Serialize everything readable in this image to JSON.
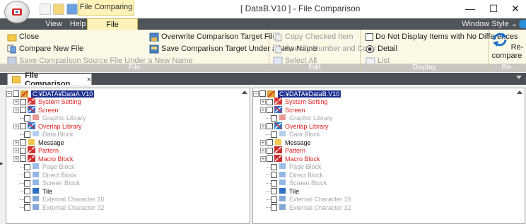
{
  "titlebar": {
    "context_tab_title": "File Comparing",
    "window_title": "[ DataB.V10 ] - File Comparison",
    "qat_more": "»",
    "minimize": "—",
    "maximize": "☐",
    "close": "✕"
  },
  "tabs": {
    "view": "View",
    "help": "Help",
    "file_comparing": "File Comparing",
    "window_style": "Window Style ⌄"
  },
  "ribbon": {
    "file_group": {
      "label": "File",
      "close": "Close",
      "compare_new_file": "Compare New File",
      "save_source_new_name": "Save Comparison Source File Under a New Name",
      "overwrite_target": "Overwrite Comparison Target File",
      "save_target_new_name": "Save Comparison Target Under a New Name"
    },
    "edit_group": {
      "label": "Edit",
      "copy_checked": "Copy Checked Item",
      "specify_number_copy": "Specify Number and Copy",
      "select_all": "Select All"
    },
    "display_group": {
      "label": "Display",
      "no_diff": "Do Not Display Items with No Differences",
      "detail": "Detail",
      "list": "List"
    },
    "recompare_group": {
      "label": "Re-compare",
      "button": "Re-compare"
    }
  },
  "doc_tab": {
    "title": "File Comparison",
    "close": "×"
  },
  "left_pane": {
    "root": "C:¥DATA¥DataA.V10",
    "items": [
      {
        "label": "System Setting",
        "status": "red",
        "expand": true
      },
      {
        "label": "Screen",
        "status": "red",
        "expand": true
      },
      {
        "label": "Graphic Library",
        "status": "gray",
        "expand": false
      },
      {
        "label": "Overlap Library",
        "status": "red",
        "expand": true
      },
      {
        "label": "Data Block",
        "status": "gray",
        "expand": false
      },
      {
        "label": "Message",
        "status": "black",
        "expand": true
      },
      {
        "label": "Pattern",
        "status": "red",
        "expand": true
      },
      {
        "label": "Macro Block",
        "status": "red",
        "expand": true
      },
      {
        "label": "Page Block",
        "status": "gray",
        "expand": false
      },
      {
        "label": "Direct Block",
        "status": "gray",
        "expand": false
      },
      {
        "label": "Screen Block",
        "status": "gray",
        "expand": false
      },
      {
        "label": "Tile",
        "status": "black",
        "expand": false
      },
      {
        "label": "External Character 16",
        "status": "gray",
        "expand": false
      },
      {
        "label": "External Character 32",
        "status": "gray",
        "expand": false
      }
    ]
  },
  "right_pane": {
    "root": "C:¥DATA¥DataB.V10",
    "items": [
      {
        "label": "System Setting",
        "status": "red",
        "expand": true
      },
      {
        "label": "Screen",
        "status": "red",
        "expand": true
      },
      {
        "label": "Graphic Library",
        "status": "gray",
        "expand": false
      },
      {
        "label": "Overlap Library",
        "status": "red",
        "expand": true
      },
      {
        "label": "Data Block",
        "status": "gray",
        "expand": false
      },
      {
        "label": "Message",
        "status": "black",
        "expand": true
      },
      {
        "label": "Pattern",
        "status": "red",
        "expand": true
      },
      {
        "label": "Macro Block",
        "status": "red",
        "expand": true
      },
      {
        "label": "Page Block",
        "status": "gray",
        "expand": false
      },
      {
        "label": "Direct Block",
        "status": "gray",
        "expand": false
      },
      {
        "label": "Screen Block",
        "status": "gray",
        "expand": false
      },
      {
        "label": "Tile",
        "status": "black",
        "expand": false
      },
      {
        "label": "External Character 16",
        "status": "gray",
        "expand": false
      },
      {
        "label": "External Character 32",
        "status": "gray",
        "expand": false
      }
    ]
  },
  "icons": {
    "red_diff": "red-diff-icon",
    "screen": "screen-icon",
    "folder": "folder-icon"
  },
  "colors": {
    "diff_red": "#e02020",
    "inactive_gray": "#a7a7a7",
    "selection_navy": "#1b2e8f",
    "ribbon_bg": "#fbf8e6",
    "tab_yellow": "#fdf2b8"
  }
}
